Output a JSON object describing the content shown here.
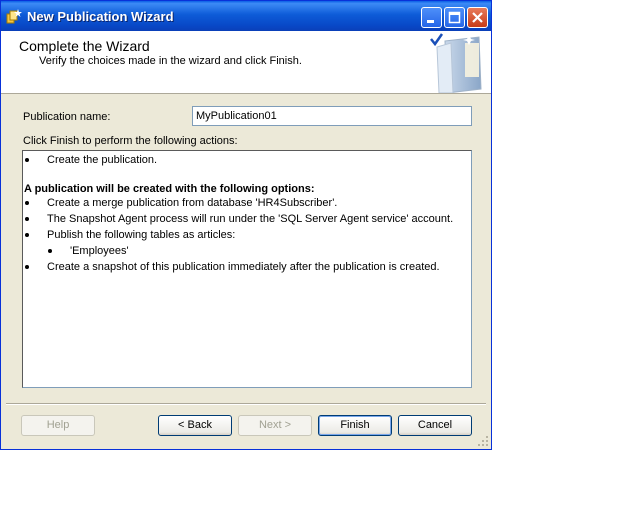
{
  "window": {
    "title": "New Publication Wizard"
  },
  "header": {
    "title": "Complete the Wizard",
    "subtitle": "Verify the choices made in the wizard and click Finish."
  },
  "form": {
    "publication_name_label": "Publication name:",
    "publication_name_value": "MyPublication01",
    "actions_label": "Click Finish to perform the following actions:"
  },
  "actions": {
    "create_publication": "Create the publication.",
    "options_heading": "A publication will be created with the following options:",
    "merge_from_db": "Create a merge publication from database 'HR4Subscriber'.",
    "snapshot_agent": "The Snapshot Agent process will run under the 'SQL Server Agent service' account.",
    "publish_tables": "Publish the following tables as articles:",
    "table_employees": "'Employees'",
    "create_snapshot": "Create a snapshot of this publication immediately after the publication is created."
  },
  "buttons": {
    "help": "Help",
    "back": "< Back",
    "next": "Next >",
    "finish": "Finish",
    "cancel": "Cancel"
  },
  "colors": {
    "titlebar": "#0a5fe6",
    "dialog_bg": "#ece9d8",
    "field_border": "#7f9db9"
  }
}
